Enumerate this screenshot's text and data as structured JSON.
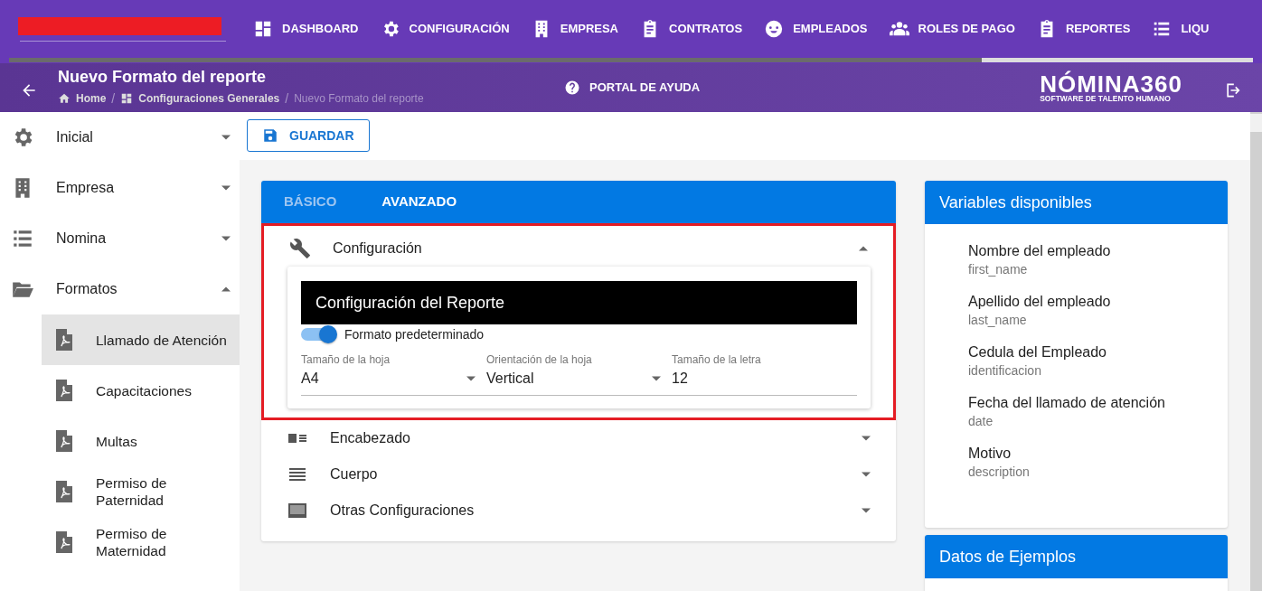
{
  "nav": {
    "items": [
      {
        "label": "DASHBOARD"
      },
      {
        "label": "CONFIGURACIÓN"
      },
      {
        "label": "EMPRESA"
      },
      {
        "label": "CONTRATOS"
      },
      {
        "label": "EMPLEADOS"
      },
      {
        "label": "ROLES DE PAGO"
      },
      {
        "label": "REPORTES"
      },
      {
        "label": "LIQU"
      }
    ]
  },
  "header": {
    "title": "Nuevo Formato del reporte",
    "breadcrumb": [
      {
        "label": "Home",
        "current": false
      },
      {
        "separator": "/",
        "label": "Configuraciones Generales",
        "current": false
      },
      {
        "separator": "/",
        "label": "Nuevo Formato del reporte",
        "current": true
      }
    ],
    "help": "PORTAL DE AYUDA",
    "brand": {
      "name": "NÓMINA360",
      "tagline": "SOFTWARE DE TALENTO HUMANO"
    }
  },
  "sidebar": {
    "items": [
      {
        "label": "Inicial",
        "expanded": false
      },
      {
        "label": "Empresa",
        "expanded": false
      },
      {
        "label": "Nomina",
        "expanded": false
      },
      {
        "label": "Formatos",
        "expanded": true,
        "children": [
          {
            "label": "Llamado de Atención",
            "selected": true
          },
          {
            "label": "Capacitaciones",
            "selected": false
          },
          {
            "label": "Multas",
            "selected": false
          },
          {
            "label": "Permiso de Paternidad",
            "selected": false
          },
          {
            "label": "Permiso de Maternidad",
            "selected": false
          }
        ]
      }
    ]
  },
  "toolbar": {
    "save": "GUARDAR"
  },
  "tabs": [
    {
      "label": "BÁSICO",
      "selected": false
    },
    {
      "label": "AVANZADO",
      "selected": true
    }
  ],
  "sections": [
    {
      "title": "Configuración",
      "expanded": true,
      "highlighted": true,
      "panel": {
        "title": "Configuración del Reporte",
        "toggle": {
          "label": "Formato predeterminado",
          "on": true
        },
        "fields": [
          {
            "label": "Tamaño de la hoja",
            "value": "A4",
            "kind": "select"
          },
          {
            "label": "Orientación de la hoja",
            "value": "Vertical",
            "kind": "select"
          },
          {
            "label": "Tamaño de la letra",
            "value": "12",
            "kind": "text"
          }
        ]
      }
    },
    {
      "title": "Encabezado",
      "expanded": false,
      "highlighted": false
    },
    {
      "title": "Cuerpo",
      "expanded": false,
      "highlighted": false
    },
    {
      "title": "Otras Configuraciones",
      "expanded": false,
      "highlighted": false
    }
  ],
  "variables": {
    "title": "Variables disponibles",
    "items": [
      {
        "name": "Nombre del empleado",
        "key": "first_name"
      },
      {
        "name": "Apellido del empleado",
        "key": "last_name"
      },
      {
        "name": "Cedula del Empleado",
        "key": "identificacion"
      },
      {
        "name": "Fecha del llamado de atención",
        "key": "date"
      },
      {
        "name": "Motivo",
        "key": "description"
      }
    ]
  },
  "examples": {
    "title": "Datos de Ejemplos"
  }
}
